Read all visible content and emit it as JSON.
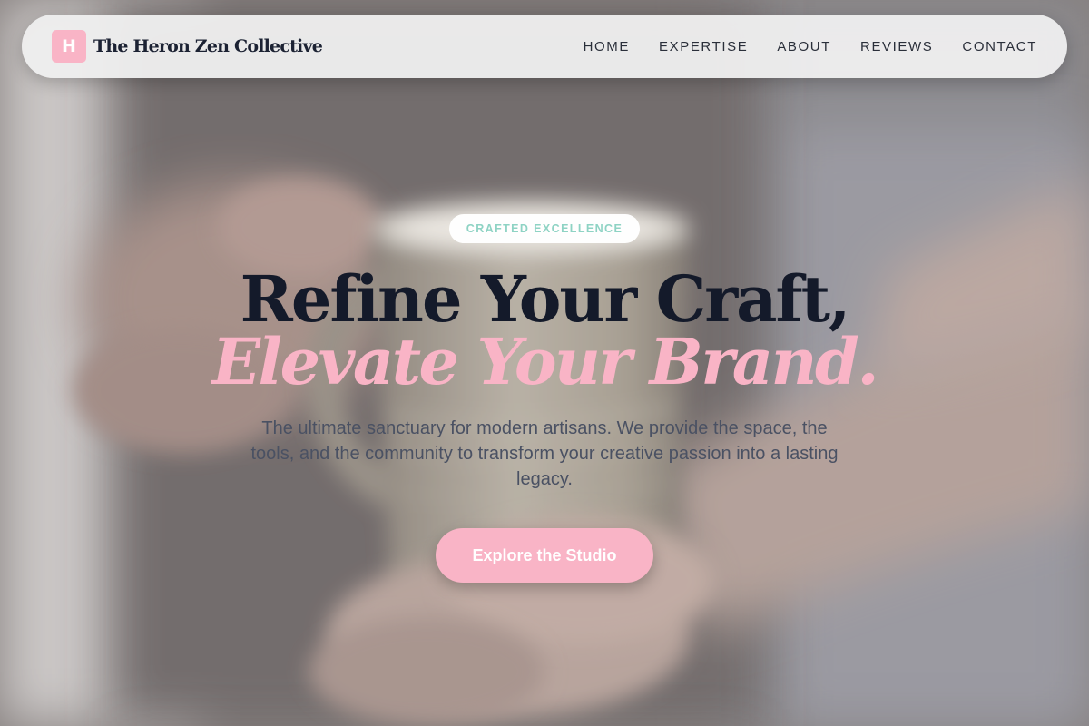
{
  "header": {
    "logo_letter": "H",
    "brand_name": "The Heron Zen Collective",
    "nav": [
      {
        "label": "HOME"
      },
      {
        "label": "EXPERTISE"
      },
      {
        "label": "ABOUT"
      },
      {
        "label": "REVIEWS"
      },
      {
        "label": "CONTACT"
      }
    ]
  },
  "hero": {
    "badge": "CRAFTED EXCELLENCE",
    "headline_line1": "Refine Your Craft,",
    "headline_line2": "Elevate Your Brand.",
    "subtitle": "The ultimate sanctuary for modern artisans. We provide the space, the tools, and the community to transform your creative passion into a lasting legacy.",
    "cta_label": "Explore the Studio"
  },
  "colors": {
    "accent_pink": "#f9b4c6",
    "badge_teal": "#8ed3c4",
    "headline_dark": "#141a2a"
  }
}
